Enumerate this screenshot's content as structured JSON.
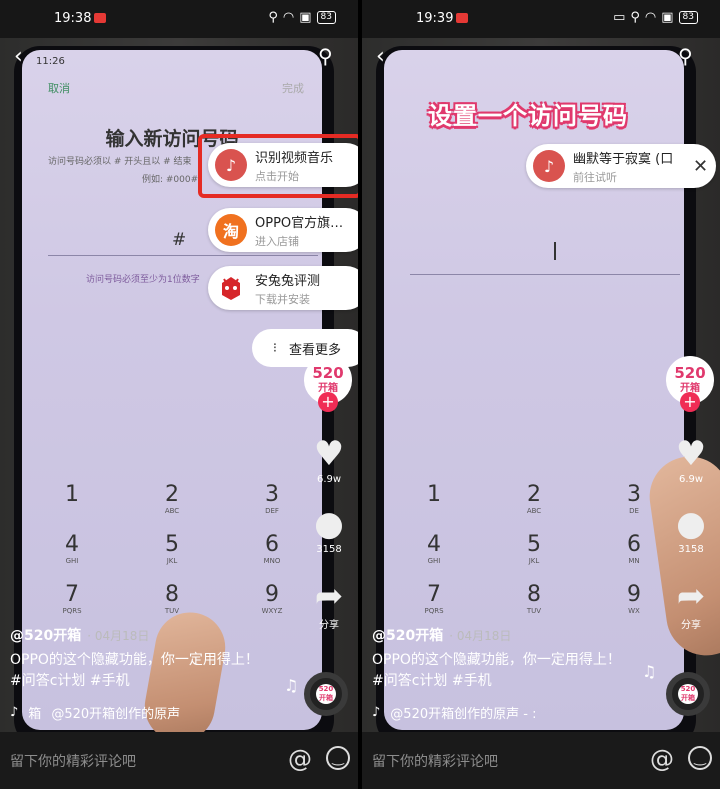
{
  "left": {
    "status": {
      "time": "19:38",
      "battery": "83"
    },
    "phone": {
      "time": "11:26",
      "cancel": "取消",
      "done": "完成",
      "title": "输入新访问号码",
      "desc": "访问号码必须以 # 开头且以 # 结束",
      "example": "例如: #000#",
      "hash": "#",
      "hint": "访问号码必须至少为1位数字",
      "keys": [
        {
          "d": "1",
          "l": ""
        },
        {
          "d": "2",
          "l": "ABC"
        },
        {
          "d": "3",
          "l": "DEF"
        },
        {
          "d": "4",
          "l": "GHI"
        },
        {
          "d": "5",
          "l": "JKL"
        },
        {
          "d": "6",
          "l": "MNO"
        },
        {
          "d": "7",
          "l": "PQRS"
        },
        {
          "d": "8",
          "l": "TUV"
        },
        {
          "d": "9",
          "l": "WXYZ"
        },
        {
          "d": "#",
          "l": ""
        }
      ]
    },
    "cards": [
      {
        "title": "识别视频音乐",
        "subtitle": "点击开始",
        "icon": "music-note-icon"
      },
      {
        "title": "OPPO官方旗…",
        "subtitle": "进入店铺",
        "icon": "taobao-icon",
        "glyph": "淘"
      },
      {
        "title": "安兔兔评测",
        "subtitle": "下载并安装",
        "icon": "antutu-icon"
      }
    ],
    "more": "查看更多",
    "avatar": {
      "line1": "520",
      "line2": "开箱"
    },
    "likes": "6.9w",
    "comments": "3158",
    "share": "分享",
    "author": "@520开箱",
    "date": "· 04月18日",
    "caption": "OPPO的这个隐藏功能，你一定用得上！#问答c计划 #手机",
    "sound_prefix": "箱",
    "sound": "@520开箱创作的原声",
    "comment_placeholder": "留下你的精彩评论吧",
    "at": "@"
  },
  "right": {
    "status": {
      "time": "19:39",
      "battery": "83"
    },
    "overlay": "设置一个访问号码",
    "card": {
      "title": "幽默等于寂寞 (口",
      "subtitle": "前往试听",
      "close": "✕"
    },
    "phone": {
      "keys": [
        {
          "d": "1",
          "l": ""
        },
        {
          "d": "2",
          "l": "ABC"
        },
        {
          "d": "3",
          "l": "DE"
        },
        {
          "d": "4",
          "l": "GHI"
        },
        {
          "d": "5",
          "l": "JKL"
        },
        {
          "d": "6",
          "l": "MN"
        },
        {
          "d": "7",
          "l": "PQRS"
        },
        {
          "d": "8",
          "l": "TUV"
        },
        {
          "d": "9",
          "l": "WX"
        }
      ]
    },
    "avatar": {
      "line1": "520",
      "line2": "开箱"
    },
    "likes": "6.9w",
    "comments": "3158",
    "share": "分享",
    "author": "@520开箱",
    "date": "· 04月18日",
    "caption": "OPPO的这个隐藏功能，你一定用得上！#问答c计划 #手机",
    "sound": "@520开箱创作的原声 - :",
    "comment_placeholder": "留下你的精彩评论吧",
    "at": "@"
  },
  "colors": {
    "accent": "#f02c55",
    "highlight": "#e52b24",
    "brand_pink": "#e0396d"
  }
}
